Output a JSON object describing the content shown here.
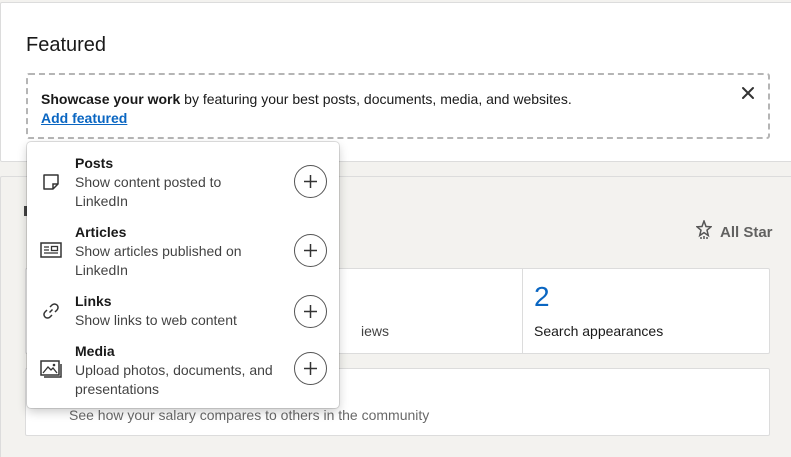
{
  "featured": {
    "title": "Featured",
    "showcase_bold": "Showcase your work",
    "showcase_rest": " by featuring your best posts, documents, media, and websites.",
    "add_link": "Add featured",
    "close_icon": "close-icon"
  },
  "dashboard": {
    "all_star_label": "All Star",
    "hidden_stat_label": "iews",
    "search_count": "2",
    "search_label": "Search appearances",
    "salary_text": "See how your salary compares to others in the community"
  },
  "dropdown": {
    "items": [
      {
        "title": "Posts",
        "desc": "Show content posted to LinkedIn",
        "icon": "post-icon"
      },
      {
        "title": "Articles",
        "desc": "Show articles published on LinkedIn",
        "icon": "article-icon"
      },
      {
        "title": "Links",
        "desc": "Show links to web content",
        "icon": "link-icon"
      },
      {
        "title": "Media",
        "desc": "Upload photos, documents, and presentations",
        "icon": "media-icon"
      }
    ]
  },
  "colors": {
    "accent": "#0a66c2",
    "page_bg": "#f3f2ef"
  }
}
